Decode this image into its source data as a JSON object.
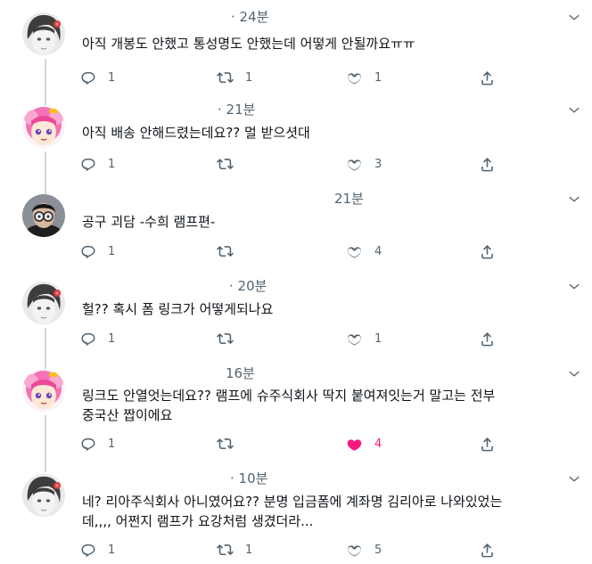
{
  "tweets": [
    {
      "time": "· 24분",
      "text": "아직 개봉도 안했고 통성명도 안했는데 어떻게 안될까요ㅠㅠ",
      "replies": "1",
      "retweets": "1",
      "likes": "1",
      "liked": false,
      "avatar": "gray-face-red-flower"
    },
    {
      "time": "· 21분",
      "text": "아직 배송 안해드렸는데요?? 멀 받으셧대",
      "replies": "1",
      "retweets": "",
      "likes": "3",
      "liked": false,
      "avatar": "pink-hair-anime"
    },
    {
      "time": "21분",
      "text": "공구 괴담 -수희 램프편-",
      "replies": "1",
      "retweets": "",
      "likes": "4",
      "liked": false,
      "avatar": "glasses-man"
    },
    {
      "time": "· 20분",
      "text": "헐?? 혹시 폼 링크가 어떻게되나요",
      "replies": "1",
      "retweets": "",
      "likes": "1",
      "liked": false,
      "avatar": "gray-face-red-flower"
    },
    {
      "time": "16분",
      "text": "링크도 안열엇는데요?? 램프에 슈주식회사 딱지 붙여져잇는거 말고는 전부\n중국산 짭이에요",
      "replies": "1",
      "retweets": "",
      "likes": "4",
      "liked": true,
      "avatar": "pink-hair-anime"
    },
    {
      "time": "· 10분",
      "text": "네? 리아주식회사 아니였어요?? 분명 입금폼에 계좌명 김리아로 나와있었는\n데,,,, 어쩐지 램프가 요강처럼 생겼더라...",
      "replies": "1",
      "retweets": "1",
      "likes": "5",
      "liked": false,
      "avatar": "gray-face-red-flower"
    }
  ],
  "colors": {
    "icon": "#536471",
    "like_active": "#f91880",
    "thread_line": "#cfd9de"
  },
  "icons": {
    "reply": "reply-icon",
    "retweet": "retweet-icon",
    "like": "heart-icon",
    "share": "share-icon",
    "more": "chevron-down-icon"
  }
}
